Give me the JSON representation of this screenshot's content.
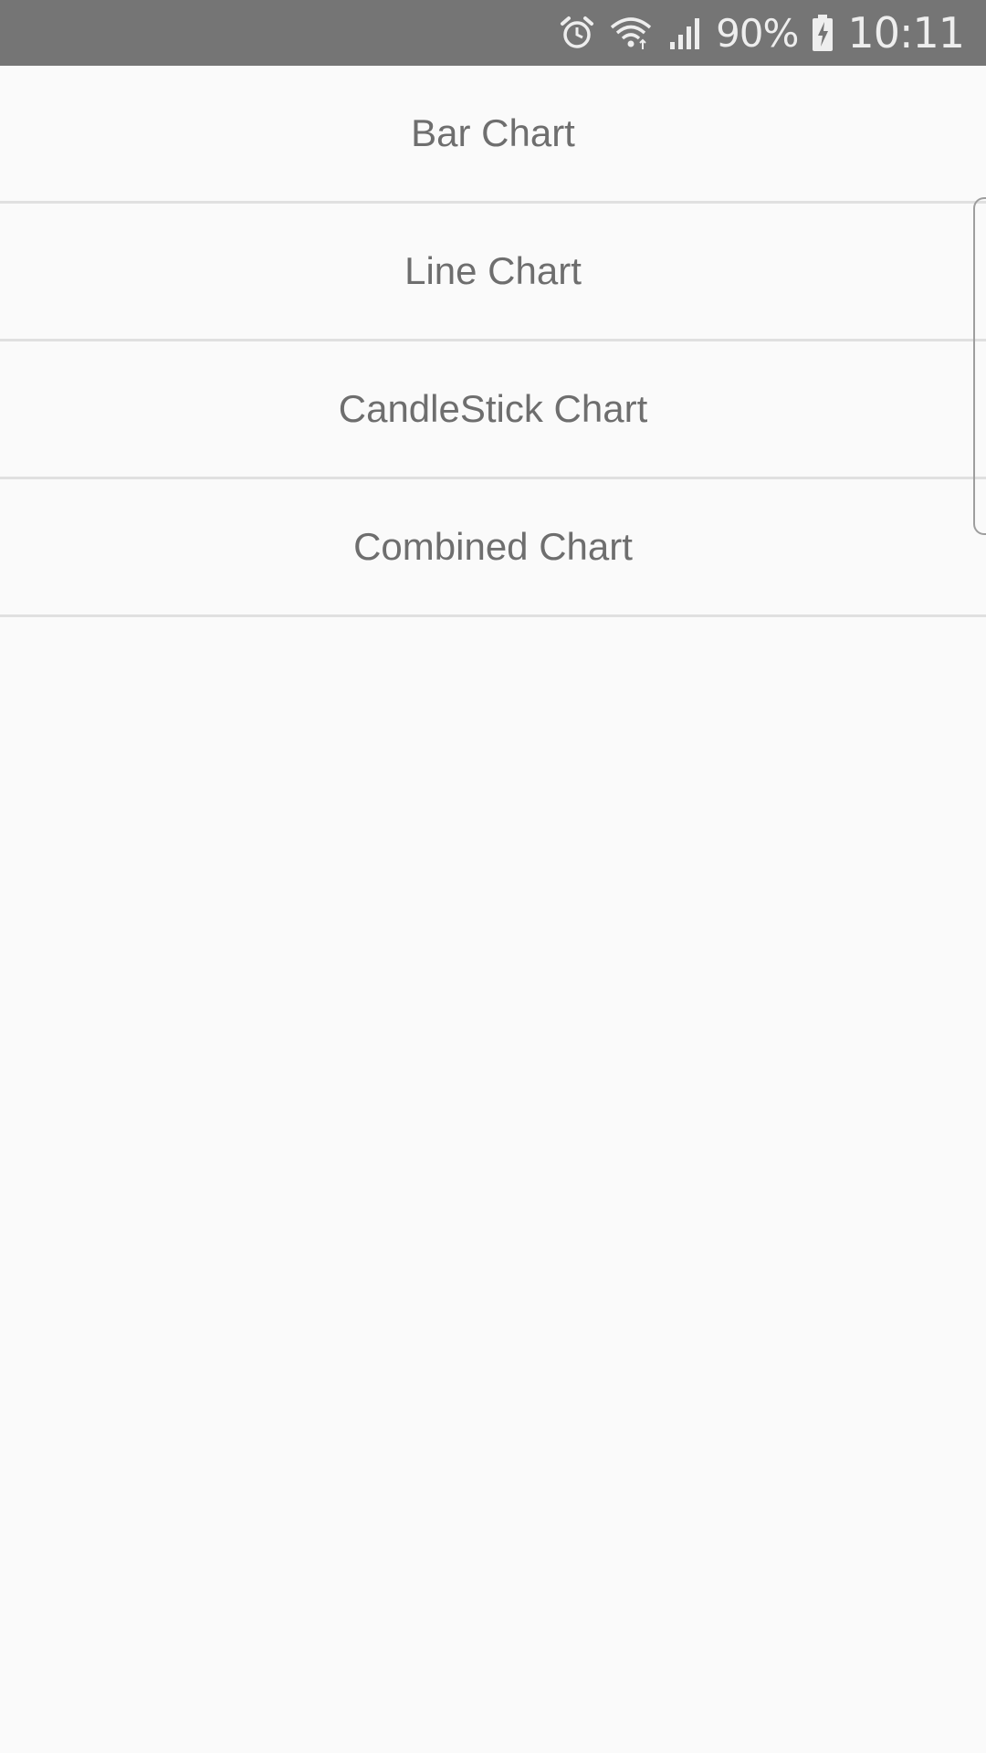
{
  "status_bar": {
    "battery_percent": "90%",
    "time": "10:11",
    "icons": [
      "alarm-icon",
      "wifi-icon",
      "signal-icon",
      "battery-charging-icon"
    ]
  },
  "list": {
    "items": [
      {
        "label": "Bar Chart"
      },
      {
        "label": "Line Chart"
      },
      {
        "label": "CandleStick Chart"
      },
      {
        "label": "Combined Chart"
      }
    ]
  },
  "colors": {
    "status_bar_bg": "#757575",
    "background": "#fafafa",
    "item_text": "#6e6e6e",
    "divider": "#e0e0e0"
  }
}
